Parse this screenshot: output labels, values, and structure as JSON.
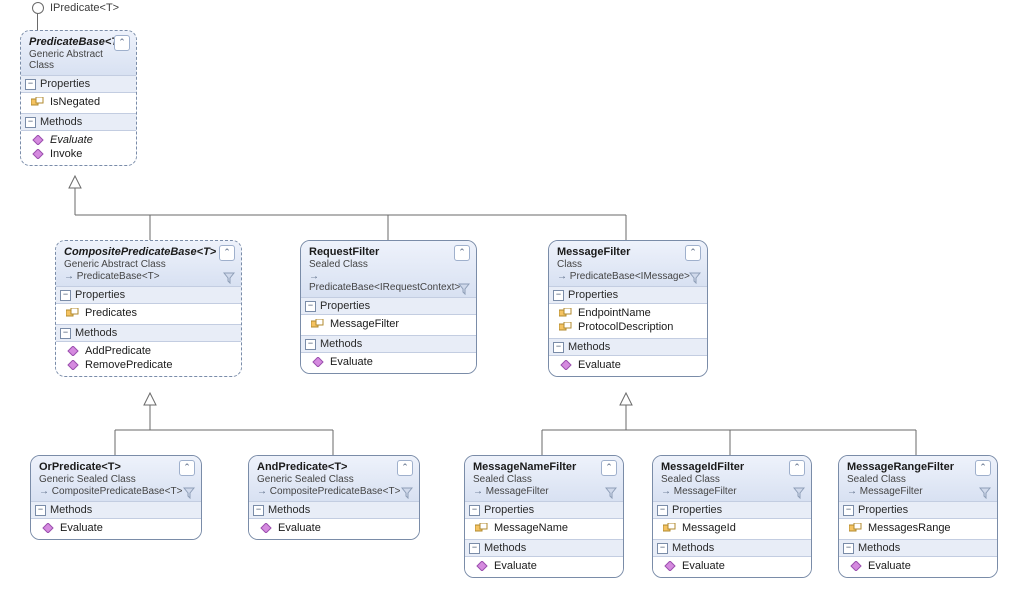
{
  "interface": {
    "name": "IPredicate<T>"
  },
  "section_labels": {
    "properties": "Properties",
    "methods": "Methods"
  },
  "classes": {
    "predicateBase": {
      "name": "PredicateBase<T>",
      "kind": "Generic Abstract Class",
      "properties": [
        "IsNegated"
      ],
      "methods": [
        "Evaluate",
        "Invoke"
      ],
      "methods_italic": [
        true,
        false
      ]
    },
    "compositePredicateBase": {
      "name": "CompositePredicateBase<T>",
      "kind": "Generic Abstract Class",
      "base": "PredicateBase<T>",
      "properties": [
        "Predicates"
      ],
      "methods": [
        "AddPredicate",
        "RemovePredicate"
      ]
    },
    "requestFilter": {
      "name": "RequestFilter",
      "kind": "Sealed Class",
      "base": "PredicateBase<IRequestContext>",
      "properties": [
        "MessageFilter"
      ],
      "methods": [
        "Evaluate"
      ]
    },
    "messageFilter": {
      "name": "MessageFilter",
      "kind": "Class",
      "base": "PredicateBase<IMessage>",
      "properties": [
        "EndpointName",
        "ProtocolDescription"
      ],
      "methods": [
        "Evaluate"
      ]
    },
    "orPredicate": {
      "name": "OrPredicate<T>",
      "kind": "Generic Sealed Class",
      "base": "CompositePredicateBase<T>",
      "methods": [
        "Evaluate"
      ]
    },
    "andPredicate": {
      "name": "AndPredicate<T>",
      "kind": "Generic Sealed Class",
      "base": "CompositePredicateBase<T>",
      "methods": [
        "Evaluate"
      ]
    },
    "messageNameFilter": {
      "name": "MessageNameFilter",
      "kind": "Sealed Class",
      "base": "MessageFilter",
      "properties": [
        "MessageName"
      ],
      "methods": [
        "Evaluate"
      ]
    },
    "messageIdFilter": {
      "name": "MessageIdFilter",
      "kind": "Sealed Class",
      "base": "MessageFilter",
      "properties": [
        "MessageId"
      ],
      "methods": [
        "Evaluate"
      ]
    },
    "messageRangeFilter": {
      "name": "MessageRangeFilter",
      "kind": "Sealed Class",
      "base": "MessageFilter",
      "properties": [
        "MessagesRange"
      ],
      "methods": [
        "Evaluate"
      ]
    }
  }
}
